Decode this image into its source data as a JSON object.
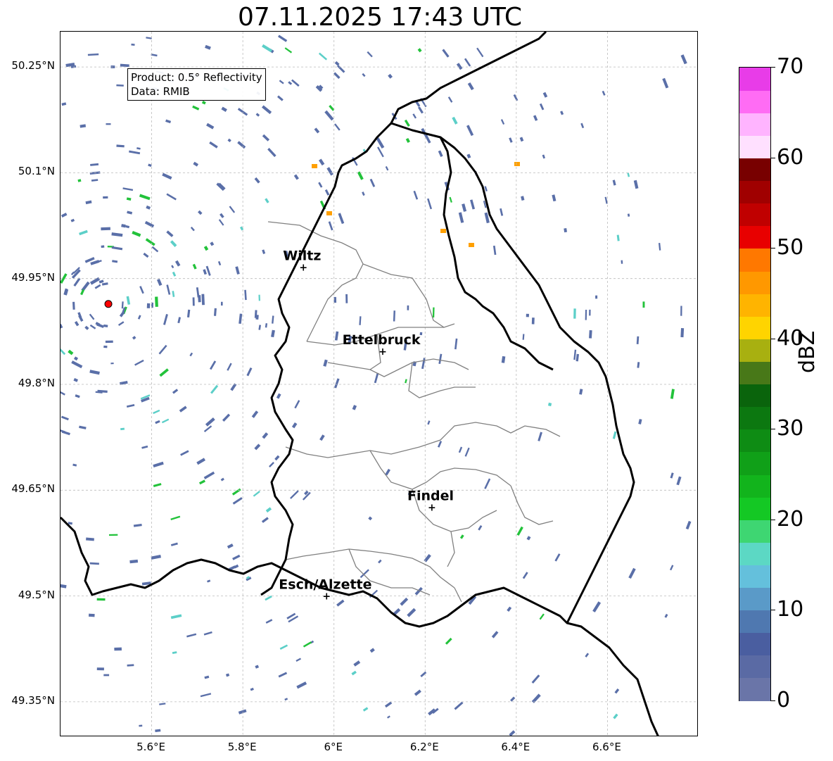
{
  "title": "07.11.2025 17:43 UTC",
  "info": {
    "product": "Product: 0.5° Reflectivity",
    "data": "Data: RMIB"
  },
  "y_ticks": [
    "50.25°N",
    "50.1°N",
    "49.95°N",
    "49.8°N",
    "49.65°N",
    "49.5°N",
    "49.35°N"
  ],
  "x_ticks": [
    "5.6°E",
    "5.8°E",
    "6°E",
    "6.2°E",
    "6.4°E",
    "6.6°E"
  ],
  "cities": [
    {
      "name": "Wiltz",
      "lon": 5.93,
      "lat": 49.966
    },
    {
      "name": "Ettelbruck",
      "lon": 6.104,
      "lat": 49.847
    },
    {
      "name": "Findel",
      "lon": 6.212,
      "lat": 49.626
    },
    {
      "name": "Esch/Alzette",
      "lon": 5.981,
      "lat": 49.5
    }
  ],
  "radar_site": {
    "lon": 5.505,
    "lat": 49.914,
    "color": "#ff0000"
  },
  "colorbar": {
    "label": "dBZ",
    "ticks": [
      "70",
      "60",
      "50",
      "40",
      "30",
      "20",
      "10",
      "0"
    ],
    "min": 0,
    "max": 70,
    "colors": [
      "#6a75a8",
      "#5a6aa4",
      "#4a5ea0",
      "#4f78b0",
      "#5a9ac8",
      "#64c0dc",
      "#5cd8c4",
      "#3ed672",
      "#14c824",
      "#12b41c",
      "#10a018",
      "#0e8c14",
      "#0c7810",
      "#0a640c",
      "#487818",
      "#a8b010",
      "#ffd400",
      "#ffb400",
      "#ff9800",
      "#ff7800",
      "#e80000",
      "#c00000",
      "#a00000",
      "#780000",
      "#ffe0ff",
      "#ffb4ff",
      "#ff6cf4",
      "#e83ce8"
    ]
  },
  "map_colors": {
    "echo_low": "#5a6fa8",
    "echo_mid": "#5ccfc8",
    "echo_high": "#22c23a",
    "echo_peak": "#ffa000",
    "border": "#000000",
    "cantons": "#808080",
    "grid": "#bbbbbb"
  }
}
